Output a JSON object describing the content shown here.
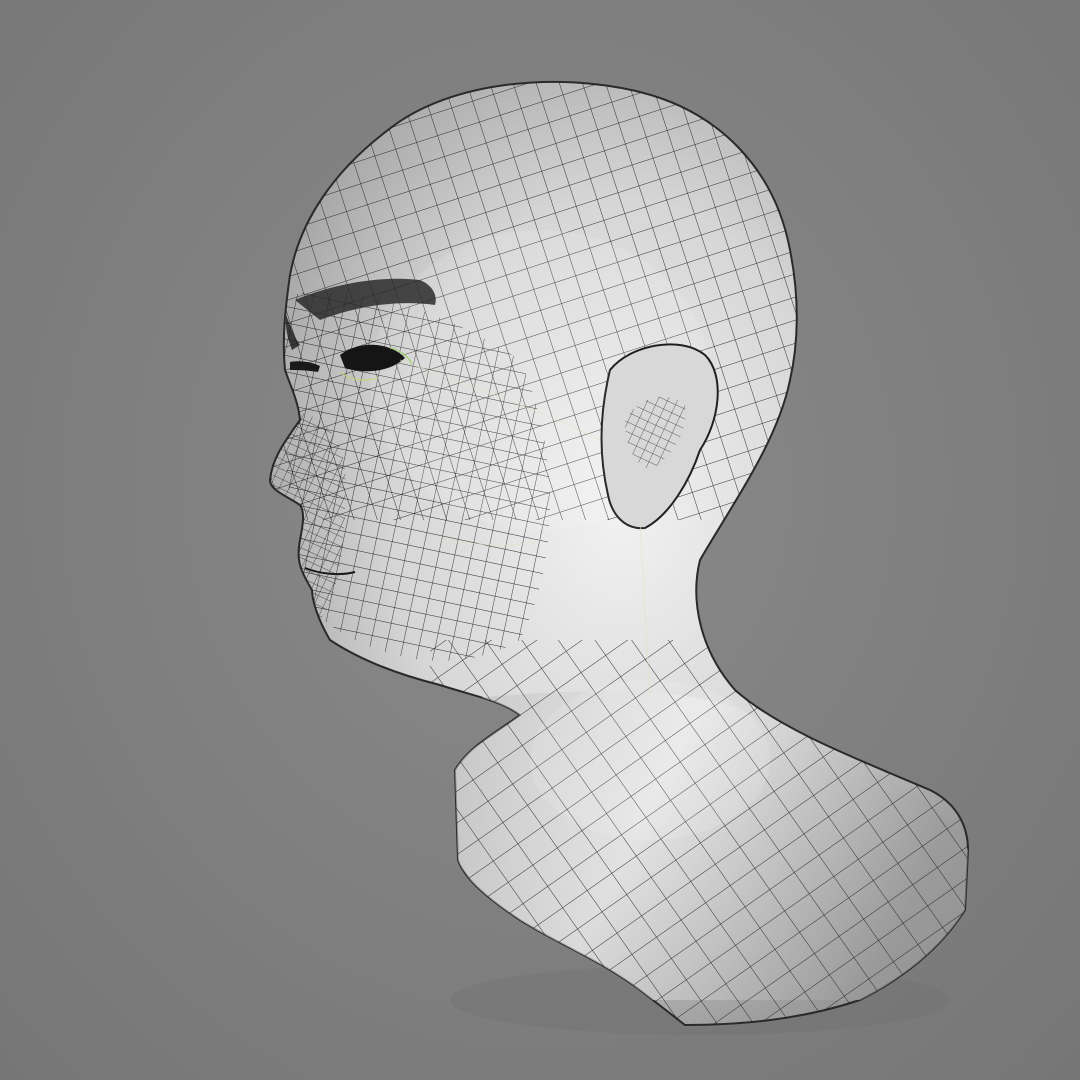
{
  "scene": {
    "background_color": "#7d7d7d",
    "mesh_fill_color": "#d4d4d4",
    "mesh_shadow_color": "#8c8c8c",
    "wire_color": "#1e1e1e",
    "icons": {
      "model": "head-mesh-icon",
      "brow": "eyebrow-icon",
      "eye": "eye-icon",
      "ear": "ear-icon"
    }
  }
}
